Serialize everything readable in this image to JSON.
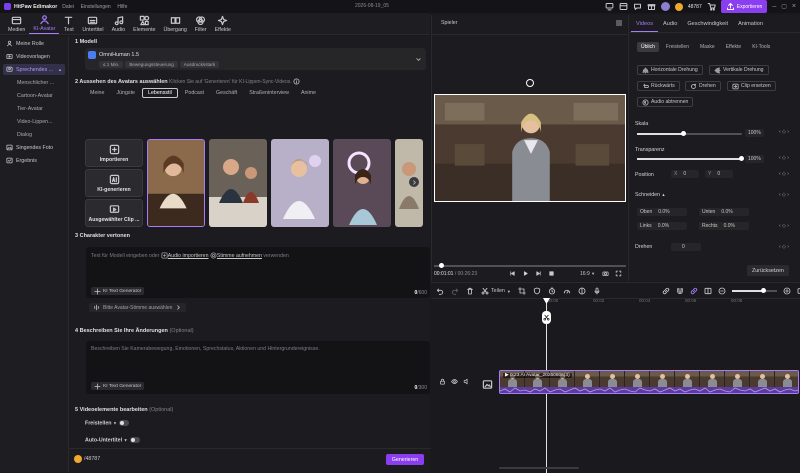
{
  "app": {
    "name": "HitPaw Edimakor",
    "menus": [
      "Datei",
      "Einstellungen",
      "Hilfe"
    ],
    "project": "2026-08-19_05",
    "credits": "48787",
    "export_label": "Exportieren"
  },
  "toolbar": [
    {
      "label": "Medien",
      "icon": "media-icon"
    },
    {
      "label": "KI-Avatar",
      "icon": "ai-avatar-icon",
      "active": true
    },
    {
      "label": "Text",
      "icon": "text-icon"
    },
    {
      "label": "Untertitel",
      "icon": "subtitle-icon"
    },
    {
      "label": "Audio",
      "icon": "audio-icon"
    },
    {
      "label": "Elemente",
      "icon": "elements-icon"
    },
    {
      "label": "Übergang",
      "icon": "transition-icon"
    },
    {
      "label": "Filter",
      "icon": "filter-icon"
    },
    {
      "label": "Effekte",
      "icon": "effects-icon"
    }
  ],
  "sidebar": [
    {
      "label": "Meine Rolle",
      "type": "top"
    },
    {
      "label": "Videovorlagen",
      "type": "top"
    },
    {
      "label": "Sprechendes ...",
      "type": "top",
      "sel": true
    },
    {
      "label": "Menschlicher ...",
      "type": "sub",
      "sel": true
    },
    {
      "label": "Cartoon-Avatar",
      "type": "sub"
    },
    {
      "label": "Tier-Avatar",
      "type": "sub"
    },
    {
      "label": "Video-Lippen...",
      "type": "sub"
    },
    {
      "label": "Dialog",
      "type": "sub"
    },
    {
      "label": "Singendes Foto",
      "type": "top"
    },
    {
      "label": "Ergebnis",
      "type": "top"
    }
  ],
  "main": {
    "sec1": {
      "num": "1",
      "title": "Modell",
      "model_name": "OmniHuman 1.5",
      "tags": [
        "≤ 1 Min.",
        "Bewegungssteuerung",
        "Ausdrucksstark"
      ]
    },
    "sec2": {
      "num": "2",
      "title": "Aussehen des Avatars auswählen",
      "hint": "Klicken Sie auf 'Generieren' für KI-Lippen-Sync-Videos.",
      "categories": [
        "Meine",
        "Jüngste",
        "Lebensstil",
        "Podcast",
        "Geschäft",
        "Straßeninterview",
        "Anime"
      ],
      "selected_category": "Lebensstil",
      "import": "Importieren",
      "ai_gen": "KI-generieren",
      "selected_clip": "Ausgewählter Clip ..."
    },
    "sec3": {
      "num": "3",
      "title": "Charakter vertonen",
      "placeholder_a": "Text für Modell eingeben oder",
      "link1": "Audio importieren",
      "link2": "Stimme aufnehmen",
      "placeholder_b": "verwenden",
      "gen": "KI Text Generator",
      "count": "0",
      "max": "/600",
      "voice": "Bitte Avatar-Stimme auswählen"
    },
    "sec4": {
      "num": "4",
      "title": "Beschreiben Sie Ihre Änderungen",
      "opt": "(Optional)",
      "placeholder": "Beschreiben Sie Kamerabewegung, Emotionen, Sprechstatus, Aktionen und Hintergrundereignisse.",
      "gen": "KI Text Generator",
      "count": "0",
      "max": "/300"
    },
    "sec5": {
      "num": "5",
      "title": "Videoelemente bearbeiten",
      "opt": "(Optional)",
      "freistellen": "Freistellen",
      "auto_untertitel": "Auto-Untertitel"
    },
    "footer": {
      "credits": "/48787",
      "generate": "Generieren"
    }
  },
  "player": {
    "title": "Spieler",
    "time_current": "00:01:01",
    "time_total": "00:26:23",
    "ratio": "16:9"
  },
  "props": {
    "tabs": [
      "Videos",
      "Audio",
      "Geschwindigkeit",
      "Animation"
    ],
    "selected_tab": "Videos",
    "subtabs": [
      "Üblich",
      "Freistellen",
      "Maske",
      "Effekte",
      "KI-Tools"
    ],
    "selected_subtab": "Üblich",
    "buttons": [
      "Horizontale Drehung",
      "Vertikale Drehung",
      "Rückwärts",
      "Drehen",
      "Clip ersetzen",
      "Audio abtrennen"
    ],
    "skala": {
      "label": "Skala",
      "value": "100%",
      "fraction": 1.0
    },
    "transparenz": {
      "label": "Transparenz",
      "value": "100%",
      "fraction": 1.0
    },
    "position": {
      "label": "Position",
      "x_label": "X",
      "x": "0",
      "y_label": "Y",
      "y": "0"
    },
    "schneiden": {
      "label": "Schneiden",
      "oben_label": "Oben",
      "oben": "0.0%",
      "unten_label": "Unten",
      "unten": "0.0%",
      "links_label": "Links",
      "links": "0.0%",
      "rechts_label": "Rechts",
      "rechts": "0.0%"
    },
    "drehen": {
      "label": "Drehen",
      "value": "0"
    },
    "reset": "Zurücksetzen"
  },
  "timeline": {
    "cut_label": "Teilen",
    "ruler": [
      "00:00",
      "00:02",
      "00:04",
      "00:06",
      "00:08"
    ],
    "clip_label": "0:23 AI Avatar_20260806(3)"
  }
}
